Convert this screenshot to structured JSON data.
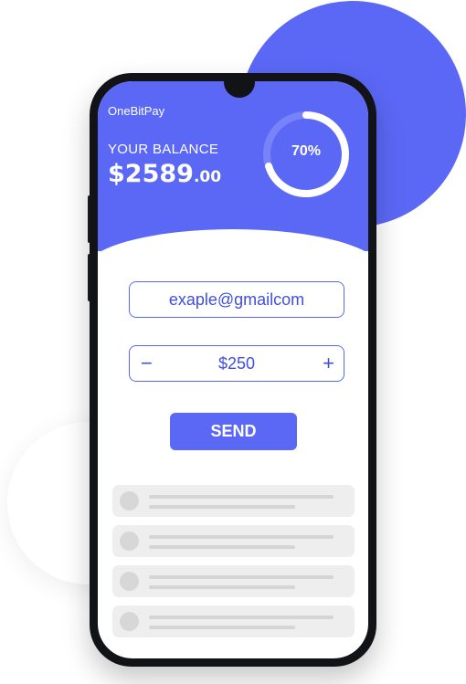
{
  "app": {
    "title": "OneBitPay"
  },
  "balance": {
    "label": "YOUR BALANCE",
    "amount_main": "$2589",
    "amount_cents": ".00"
  },
  "progress": {
    "percent_text": "70%",
    "fraction": 0.7
  },
  "form": {
    "email_value": "exaple@gmailcom",
    "amount_value": "$250",
    "minus_label": "−",
    "plus_label": "+",
    "send_label": "SEND"
  },
  "colors": {
    "accent": "#5b68f6",
    "accent_text": "#3f4fe0",
    "list_bg": "#eeeeee",
    "placeholder": "#d5d5d5"
  },
  "list": {
    "placeholder_rows": 4
  }
}
